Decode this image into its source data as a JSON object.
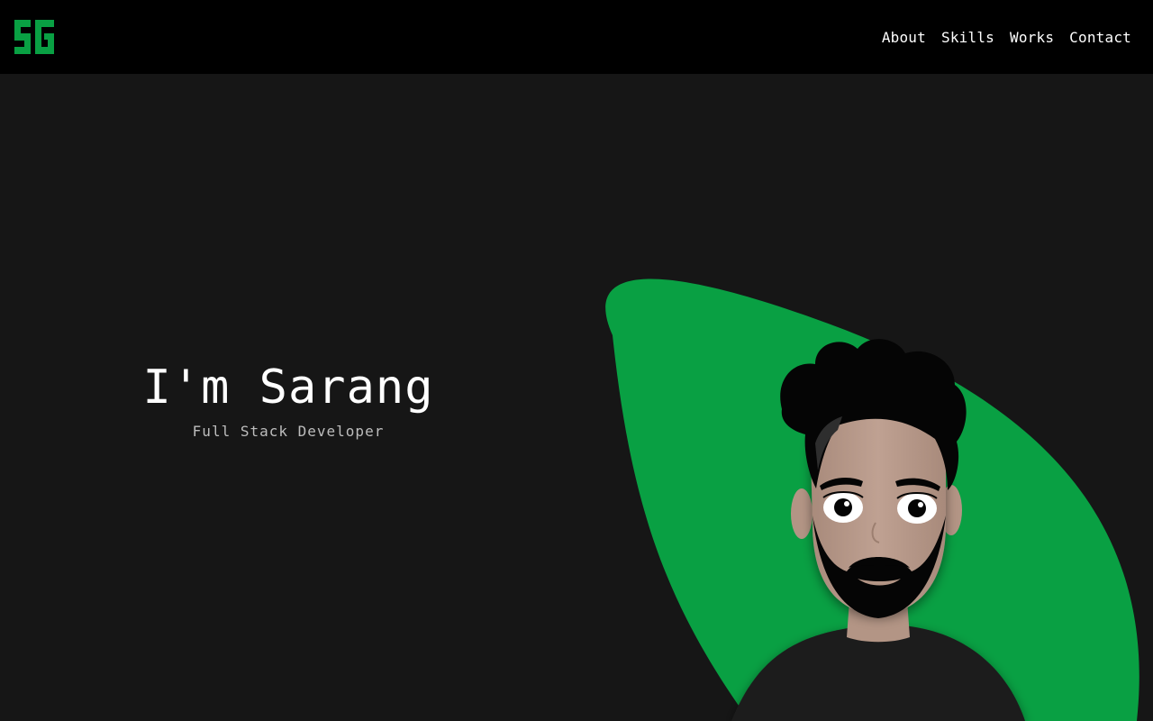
{
  "nav": {
    "logo_text": "SG",
    "items": [
      {
        "label": "About"
      },
      {
        "label": "Skills"
      },
      {
        "label": "Works"
      },
      {
        "label": "Contact"
      }
    ]
  },
  "hero": {
    "title": "I'm Sarang",
    "subtitle": "Full Stack Developer"
  },
  "colors": {
    "accent": "#09a043",
    "background": "#161616",
    "navbar": "#000000"
  },
  "icons": {
    "logo": "sg-logo-icon",
    "avatar": "avatar-illustration"
  }
}
